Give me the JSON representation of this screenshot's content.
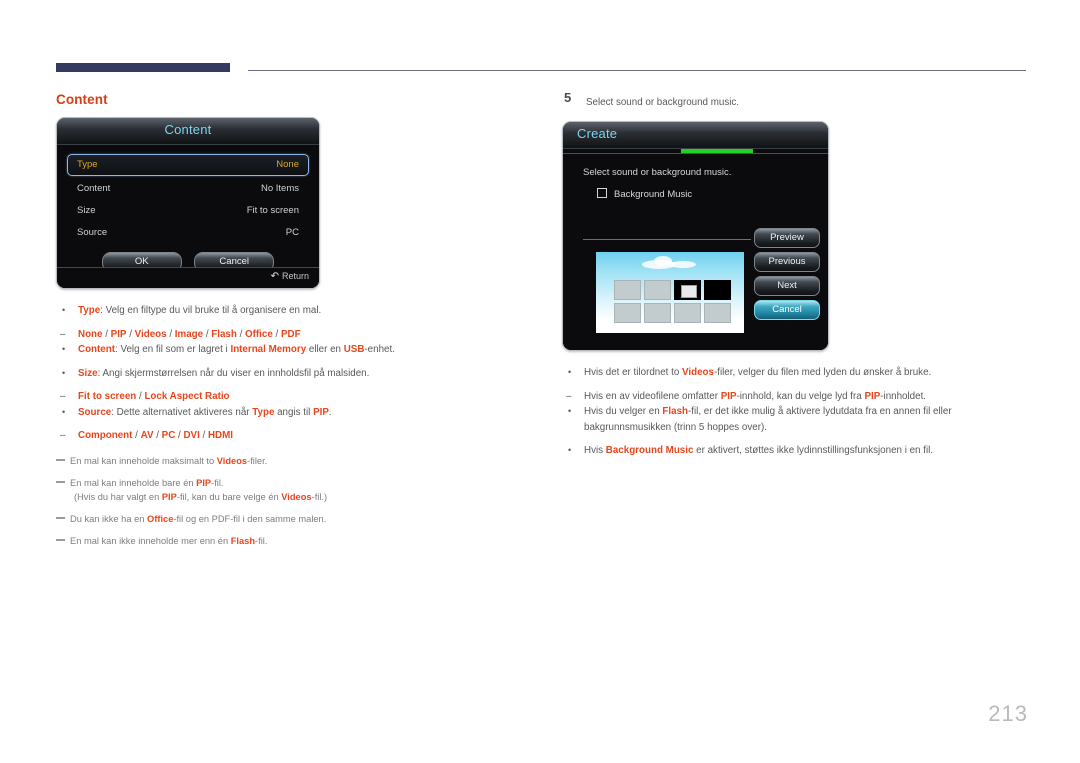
{
  "page": {
    "number": "213"
  },
  "left": {
    "section_title": "Content",
    "dialog": {
      "title": "Content",
      "rows": [
        {
          "label": "Type",
          "value": "None",
          "selected": true
        },
        {
          "label": "Content",
          "value": "No Items",
          "selected": false
        },
        {
          "label": "Size",
          "value": "Fit to screen",
          "selected": false
        },
        {
          "label": "Source",
          "value": "PC",
          "selected": false
        }
      ],
      "ok_label": "OK",
      "cancel_label": "Cancel",
      "return_label": "Return",
      "return_icon": "return-arrow-icon"
    },
    "bullets": [
      {
        "text_html": "<span class=\"kw\">Type</span>: Velg en filtype du vil bruke til å organisere en mal.",
        "sub_html": "<span class=\"kw\">None</span> / <span class=\"kw\">PIP</span> / <span class=\"kw\">Videos</span> / <span class=\"kw\">Image</span> / <span class=\"kw\">Flash</span> / <span class=\"kw\">Office</span> / <span class=\"kw\">PDF</span>"
      },
      {
        "text_html": "<span class=\"kw\">Content</span>: Velg en fil som er lagret i <span class=\"kw\">Internal Memory</span> eller en <span class=\"kw\">USB</span>-enhet.",
        "sub_html": ""
      },
      {
        "text_html": "<span class=\"kw\">Size</span>: Angi skjermstørrelsen når du viser en innholdsfil på malsiden.",
        "sub_html": "<span class=\"kw\">Fit to screen</span> / <span class=\"kw\">Lock Aspect Ratio</span>"
      },
      {
        "text_html": "<span class=\"kw\">Source</span>: Dette alternativet aktiveres når <span class=\"kw\">Type</span> angis til <span class=\"kw\">PIP</span>.",
        "sub_html": "<span class=\"kw\">Component</span> / <span class=\"kw\">AV</span> / <span class=\"kw\">PC</span> / <span class=\"kw\">DVI</span> / <span class=\"kw\">HDMI</span>"
      }
    ],
    "notes": [
      {
        "text_html": "En mal kan inneholde maksimalt to <span class=\"kw\">Videos</span>-filer."
      },
      {
        "text_html": "En mal kan inneholde bare én <span class=\"kw\">PIP</span>-fil.<span class=\"note-sub\">(Hvis du har valgt en <span class=\"kw\">PIP</span>-fil, kan du bare velge én <span class=\"kw\">Videos</span>-fil.)</span>"
      },
      {
        "text_html": "Du kan ikke ha en <span class=\"kw\">Office</span>-fil og en PDF-fil i den samme malen."
      },
      {
        "text_html": "En mal kan ikke inneholde mer enn én <span class=\"kw\">Flash</span>-fil."
      }
    ]
  },
  "right": {
    "step": {
      "number": "5",
      "text": "Select sound or background music."
    },
    "dialog": {
      "title": "Create",
      "prompt": "Select sound or background music.",
      "checkbox_label": "Background Music",
      "checkbox_checked": false,
      "progress_color": "#25d025",
      "buttons": [
        {
          "label": "Preview",
          "highlight": false
        },
        {
          "label": "Previous",
          "highlight": false
        },
        {
          "label": "Next",
          "highlight": false
        },
        {
          "label": "Cancel",
          "highlight": true
        }
      ],
      "preview": {
        "name": "template-preview-thumbnail",
        "tiles_rows": 2,
        "tiles_per_row": 4,
        "audio_tile_index": 2,
        "dark_tile_index": 3
      }
    },
    "bullets": [
      {
        "text_html": "Hvis det er tilordnet to <span class=\"kw\">Videos</span>-filer, velger du filen med lyden du ønsker å bruke.",
        "sub_html": "Hvis en av videofilene omfatter <span class=\"kw\">PIP</span>-innhold, kan du velge lyd fra <span class=\"kw\">PIP</span>-innholdet."
      },
      {
        "text_html": "Hvis du velger en <span class=\"kw\">Flash</span>-fil, er det ikke mulig å aktivere lydutdata fra en annen fil eller bakgrunnsmusikken (trinn 5 hoppes over).",
        "sub_html": ""
      },
      {
        "text_html": "Hvis <span class=\"kw\">Background Music</span> er aktivert, støttes ikke lydinnstillingsfunksjonen i en fil.",
        "sub_html": ""
      }
    ]
  },
  "theme": {
    "accent_red": "#e8461c",
    "heading_red": "#d73d14",
    "header_navy": "#343b5e",
    "osd_title_cyan": "#7fd4ef",
    "osd_selected_amber": "#dba520",
    "progress_green": "#25d025"
  }
}
